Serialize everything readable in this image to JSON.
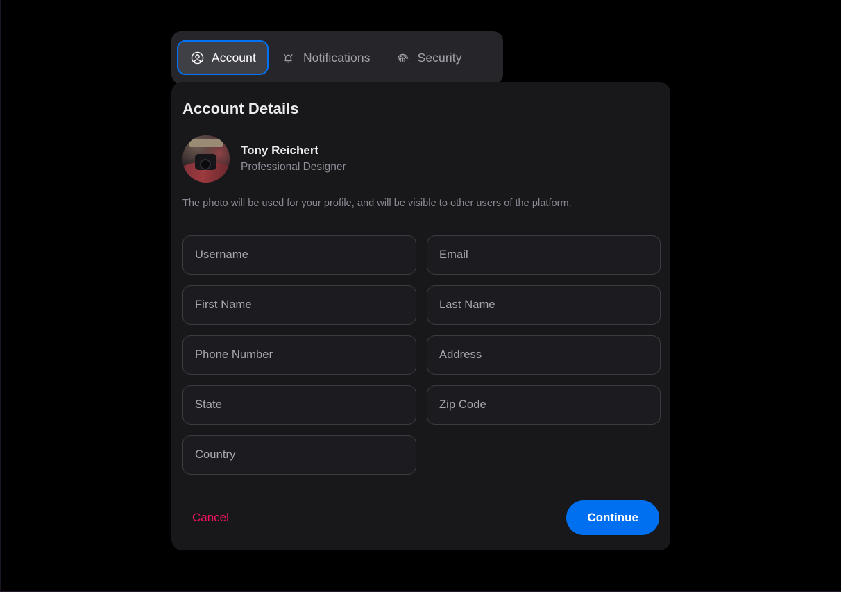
{
  "tabs": [
    {
      "id": "account",
      "label": "Account",
      "icon": "user-circle-icon",
      "active": true
    },
    {
      "id": "notifications",
      "label": "Notifications",
      "icon": "bell-icon",
      "active": false
    },
    {
      "id": "security",
      "label": "Security",
      "icon": "fingerprint-icon",
      "active": false
    }
  ],
  "card": {
    "title": "Account Details",
    "profile": {
      "name": "Tony Reichert",
      "role": "Professional Designer",
      "avatar_alt": "photographer-holding-camera"
    },
    "photo_note": "The photo will be used for your profile, and will be visible to other users of the platform."
  },
  "form": {
    "fields": [
      {
        "id": "username",
        "placeholder": "Username",
        "value": ""
      },
      {
        "id": "email",
        "placeholder": "Email",
        "value": ""
      },
      {
        "id": "first-name",
        "placeholder": "First Name",
        "value": ""
      },
      {
        "id": "last-name",
        "placeholder": "Last Name",
        "value": ""
      },
      {
        "id": "phone-number",
        "placeholder": "Phone Number",
        "value": ""
      },
      {
        "id": "address",
        "placeholder": "Address",
        "value": ""
      },
      {
        "id": "state",
        "placeholder": "State",
        "value": ""
      },
      {
        "id": "zip-code",
        "placeholder": "Zip Code",
        "value": ""
      },
      {
        "id": "country",
        "placeholder": "Country",
        "value": ""
      }
    ]
  },
  "footer": {
    "cancel_label": "Cancel",
    "continue_label": "Continue"
  },
  "colors": {
    "page_background": "#000000",
    "tabbar_background": "#26262a",
    "card_background": "#18181b",
    "active_tab_background": "#3f3f46",
    "focus_ring": "#0072f5",
    "primary_button": "#0070f0",
    "danger_text": "#f31260",
    "field_border": "#3b3b42",
    "text_primary": "#ececee",
    "text_muted": "#8f8f99"
  }
}
